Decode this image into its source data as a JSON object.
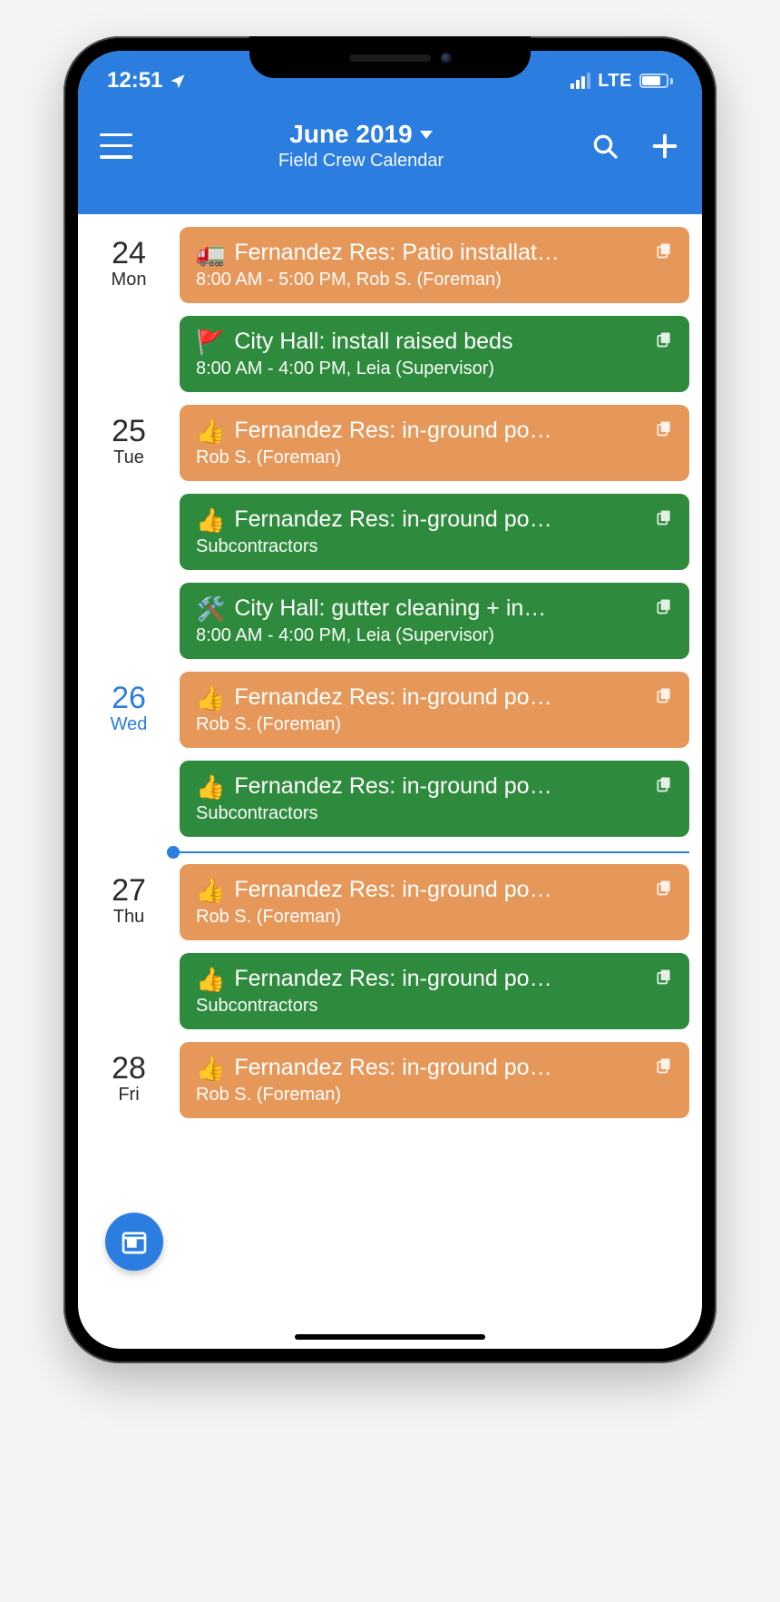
{
  "status": {
    "time": "12:51",
    "network": "LTE"
  },
  "header": {
    "title": "June 2019",
    "subtitle": "Field Crew Calendar"
  },
  "colors": {
    "orange": "#e6985a",
    "green": "#2e8b3d",
    "accent": "#2b7de0"
  },
  "days": [
    {
      "num": "24",
      "name": "Mon",
      "today": false,
      "events": [
        {
          "emoji": "🚛",
          "title": "Fernandez Res: Patio installat…",
          "sub": "8:00 AM - 5:00 PM, Rob S. (Foreman)",
          "color": "orange"
        },
        {
          "emoji": "🚩",
          "title": "City Hall: install raised beds",
          "sub": "8:00 AM - 4:00 PM, Leia (Supervisor)",
          "color": "green"
        }
      ]
    },
    {
      "num": "25",
      "name": "Tue",
      "today": false,
      "events": [
        {
          "emoji": "👍",
          "title": "Fernandez Res: in-ground po…",
          "sub": "Rob S. (Foreman)",
          "color": "orange"
        },
        {
          "emoji": "👍",
          "title": "Fernandez Res: in-ground po…",
          "sub": "Subcontractors",
          "color": "green"
        },
        {
          "emoji": "🛠️",
          "title": "City Hall: gutter cleaning + in…",
          "sub": "8:00 AM - 4:00 PM, Leia (Supervisor)",
          "color": "green"
        }
      ]
    },
    {
      "num": "26",
      "name": "Wed",
      "today": true,
      "events": [
        {
          "emoji": "👍",
          "title": "Fernandez Res: in-ground po…",
          "sub": "Rob S. (Foreman)",
          "color": "orange"
        },
        {
          "emoji": "👍",
          "title": "Fernandez Res: in-ground po…",
          "sub": "Subcontractors",
          "color": "green"
        }
      ],
      "nowLineAfter": true
    },
    {
      "num": "27",
      "name": "Thu",
      "today": false,
      "events": [
        {
          "emoji": "👍",
          "title": "Fernandez Res: in-ground po…",
          "sub": "Rob S. (Foreman)",
          "color": "orange"
        },
        {
          "emoji": "👍",
          "title": "Fernandez Res: in-ground po…",
          "sub": "Subcontractors",
          "color": "green"
        }
      ]
    },
    {
      "num": "28",
      "name": "Fri",
      "today": false,
      "events": [
        {
          "emoji": "👍",
          "title": "Fernandez Res: in-ground po…",
          "sub": "Rob S. (Foreman)",
          "color": "orange"
        }
      ]
    }
  ]
}
